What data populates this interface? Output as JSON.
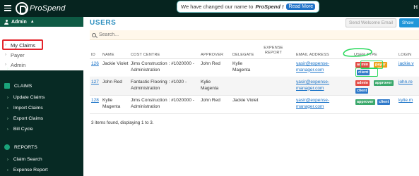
{
  "topbar": {
    "logo_text": "ProSpend",
    "announcement": {
      "text": "We have changed our name to",
      "brand": "ProSpend !",
      "button": "Read More"
    },
    "user_initial": "H"
  },
  "sidebar": {
    "admin_label": "Admin",
    "admin_submenu": [
      {
        "label": "My Claims",
        "active": true
      },
      {
        "label": "Payer",
        "active": false
      },
      {
        "label": "Admin",
        "active": false
      }
    ],
    "users_label": "Users",
    "claims_section": {
      "title": "CLAIMS",
      "items": [
        "Update Claims",
        "Import Claims",
        "Export Claims",
        "Bill Cycle"
      ]
    },
    "reports_section": {
      "title": "REPORTS",
      "items": [
        "Claim Search",
        "Expense Report"
      ]
    }
  },
  "main": {
    "title": "USERS",
    "buttons": {
      "welcome": "Send Welcome Email",
      "show": "Show"
    },
    "search": {
      "placeholder": "Search..."
    },
    "columns": [
      "ID",
      "NAME",
      "COST CENTRE",
      "APPROVER",
      "DELEGATE",
      "EXPENSE REPORT",
      "EMAIL ADDRESS",
      "USER TYPE",
      "LOGIN"
    ],
    "rows": [
      {
        "id": "126",
        "name": "Jackie Violet",
        "cost_centre": "Jims Construction : #1020000 - Administration",
        "approver": "John Red",
        "delegate": "Kylie Magenta",
        "expense_report": "",
        "email": "yasir@expense-manager.com",
        "user_types": [
          "admin",
          "payer",
          "client"
        ],
        "login": "jackie.v"
      },
      {
        "id": "127",
        "name": "John Red",
        "cost_centre": "Fantastic Flooring : #1020 - Administration",
        "approver": "Kylie Magenta",
        "delegate": "",
        "expense_report": "",
        "email": "yasir@expense-manager.com",
        "user_types": [
          "admin",
          "approver",
          "client"
        ],
        "login": "john.re"
      },
      {
        "id": "128",
        "name": "Kylie Magenta",
        "cost_centre": "Jims Construction : #1020000 - Administration",
        "approver": "John Red",
        "delegate": "Jackie Violet",
        "expense_report": "",
        "email": "yasir@expense-manager.com",
        "user_types": [
          "approver",
          "client"
        ],
        "login": "kylie.m"
      }
    ],
    "footer": "3 items found, displaying 1 to 3."
  },
  "colors": {
    "sidebar_bg": "#072a24",
    "accent": "#2d8fbf",
    "admin_badge": "#e34a44",
    "payer_badge": "#f0a11b",
    "client_badge": "#2f79c9",
    "approver_badge": "#3aa86b",
    "highlight_red": "#e3242b",
    "highlight_green": "#29d95b"
  }
}
